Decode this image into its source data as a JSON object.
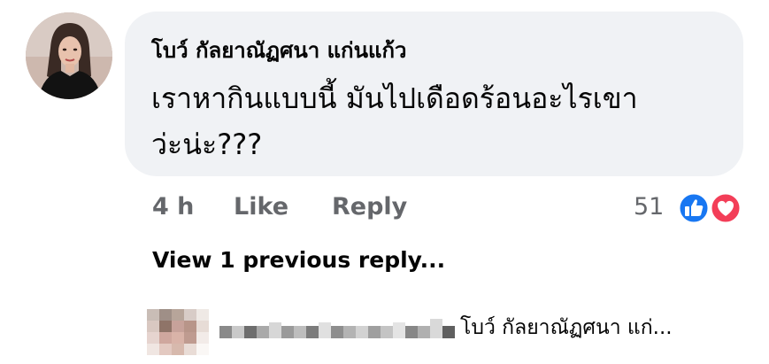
{
  "comment": {
    "author": "โบว์ กัลยาณัฏศนา แก่นแก้ว",
    "text": "เราหากินแบบนี้ มันไปเดือดร้อนอะไรเขาว่ะน่ะ???"
  },
  "actions": {
    "time": "4 h",
    "like_label": "Like",
    "reply_label": "Reply"
  },
  "reactions": {
    "count": "51",
    "types": [
      "like-icon",
      "love-icon"
    ],
    "colors": {
      "like": "#1877f2",
      "love": "#f33e58"
    }
  },
  "replies": {
    "view_previous_label": "View 1 previous reply...",
    "preview_text": "โบว์ กัลยาณัฏศนา แก่..."
  }
}
